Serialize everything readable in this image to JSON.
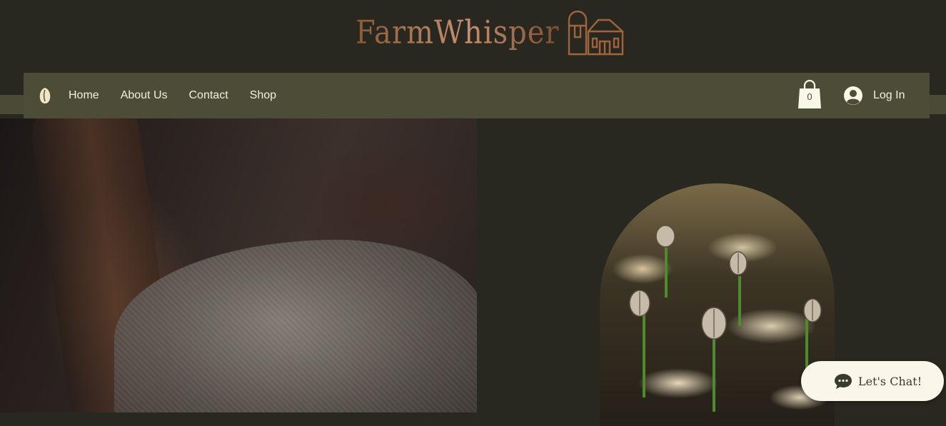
{
  "brand": {
    "name": "FarmWhisper"
  },
  "nav": {
    "items": [
      {
        "label": "Home"
      },
      {
        "label": "About Us"
      },
      {
        "label": "Contact"
      },
      {
        "label": "Shop"
      }
    ],
    "cart_count": "0",
    "login_label": "Log In"
  },
  "chat": {
    "label": "Let's Chat!"
  },
  "colors": {
    "background": "#292820",
    "navbar": "#4d4c36",
    "brand_copper": "#a66b47",
    "nav_text": "#f4efe2",
    "chat_bg": "#fbf6ea"
  },
  "icons": {
    "nav_logo": "seed-icon",
    "cart": "shopping-bag-icon",
    "login": "user-avatar-icon",
    "chat": "chat-bubble-icon"
  }
}
